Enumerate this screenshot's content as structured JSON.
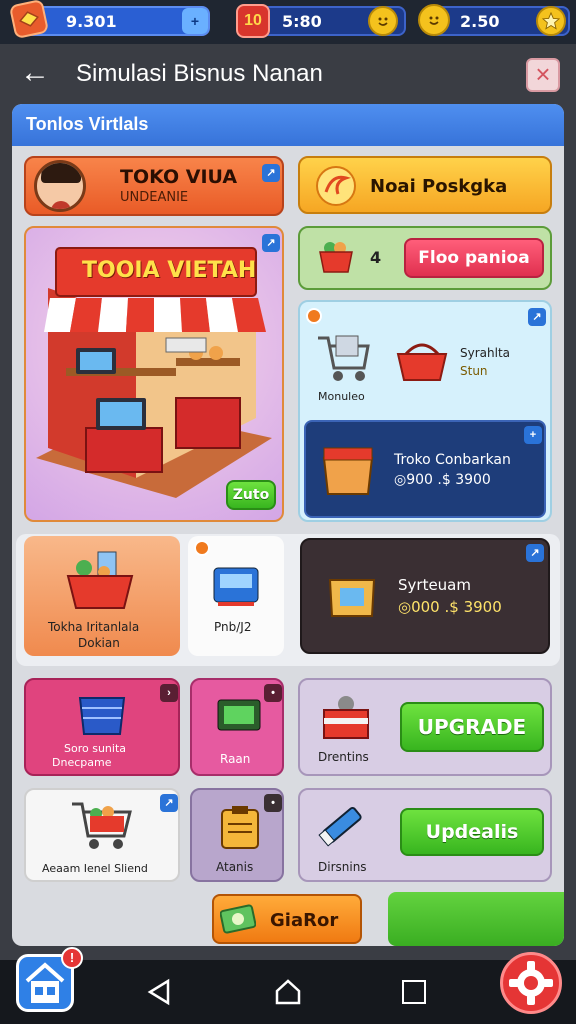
{
  "topbar": {
    "res1": {
      "icon": "diamond-card-icon",
      "value": "9.301",
      "plus": "+"
    },
    "res2": {
      "icon": "ticket-icon",
      "badge": "10",
      "value": "5:80",
      "extra": "smiley-coin-icon"
    },
    "res3": {
      "icon": "smiley-coin-icon",
      "value": "2.50",
      "extra": "star-icon"
    }
  },
  "header": {
    "title": "Simulasi Bisnus Nanan",
    "back": "←",
    "close": "×"
  },
  "panel": {
    "title": "Tonlos Virtlals",
    "toko_card": {
      "title": "TOKO VIUA",
      "subtitle": "UNDEANIE"
    },
    "noai_card": {
      "label": "Noai Poskgka"
    },
    "store_card": {
      "sign": "TOOIA VIETAH",
      "button": "Zuto"
    },
    "stock_row": {
      "count": "4",
      "button": "Floo panioa"
    },
    "items_card": {
      "label1": "Monuleo",
      "label2a": "Syrahlta",
      "label2b": "Stun"
    },
    "toko_conb": {
      "title": "Troko Conbarkan",
      "price": "◎900 .$ 3900"
    },
    "basket_card": {
      "label1": "Tokha Iritanlala",
      "label2": "Dokian"
    },
    "pnb_card": {
      "label": "Pnb/J2"
    },
    "syst_card": {
      "title": "Syrteuam",
      "price": "◎000 .$ 3900"
    },
    "row3": {
      "c1": {
        "label1": "Soro sunita",
        "label2": "Dnecpame"
      },
      "c2": {
        "label": "Raan"
      },
      "c3": {
        "label": "Drentins",
        "button": "UPGRADE"
      }
    },
    "row4": {
      "c1": {
        "label": "Aeaam Ienel Sliend"
      },
      "c2": {
        "label": "Atanis"
      },
      "c3": {
        "label": "Dirsnins",
        "button": "Updealis"
      }
    },
    "bottom": {
      "button": "GiaRor"
    }
  },
  "colors": {
    "accent": "#2f80e6",
    "upgrade": "#3cbe22",
    "alert": "#e53535"
  }
}
